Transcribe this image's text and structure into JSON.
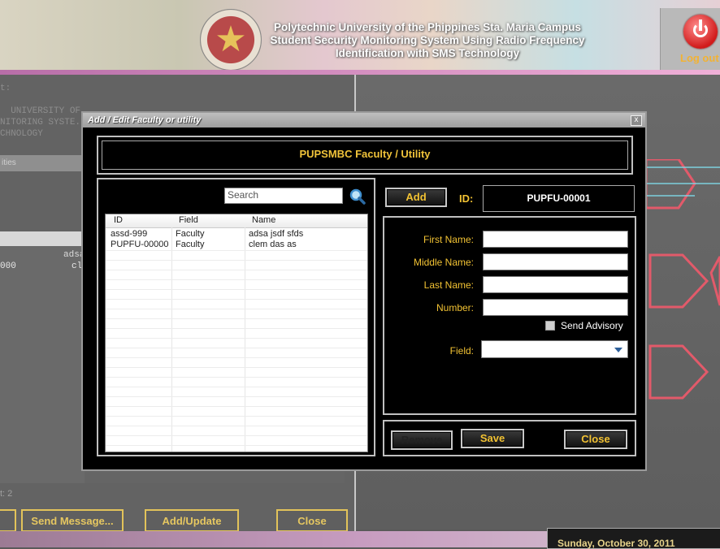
{
  "header": {
    "title_lines": [
      "Polytechnic University of the Phippines Sta. Maria Campus",
      "Student Security Monitoring System Using Radio Frequency",
      "Identification with SMS Technology"
    ],
    "logout_label": "Log out"
  },
  "background": {
    "label_top": "t:",
    "text_lines": [
      "  UNIVERSITY OF ...",
      "NITORING SYSTE...",
      "CHNOLOGY"
    ],
    "tab_label": "ities",
    "grid_fragment_a": "adsa",
    "grid_fragment_b": "000",
    "grid_fragment_c": "cl",
    "count_text": "t: 2",
    "buttons": {
      "send_message": "Send Message...",
      "add_update": "Add/Update",
      "close": "Close"
    },
    "date": "Sunday, October 30, 2011"
  },
  "dialog": {
    "title": "Add / Edit Faculty or utility",
    "close_glyph": "x",
    "banner": "PUPSMBC Faculty / Utility",
    "search": {
      "placeholder": "Search"
    },
    "grid": {
      "columns": [
        "ID",
        "Field",
        "Name"
      ],
      "rows": [
        [
          "assd-999",
          "Faculty",
          "adsa jsdf sfds"
        ],
        [
          "PUPFU-00000",
          "Faculty",
          "clem das as"
        ]
      ]
    },
    "add_button": "Add",
    "id_label": "ID:",
    "id_value": "PUPFU-00001",
    "form": {
      "first_name_label": "First Name:",
      "middle_name_label": "Middle Name:",
      "last_name_label": "Last Name:",
      "number_label": "Number:",
      "send_advisory_label": "Send Advisory",
      "field_label": "Field:",
      "field_value": ""
    },
    "buttons": {
      "remove": "Remove",
      "save": "Save",
      "close": "Close"
    }
  },
  "colors": {
    "accent": "#f2c233",
    "dialog_bg": "#000000",
    "logout_red": "#d11a1a"
  }
}
